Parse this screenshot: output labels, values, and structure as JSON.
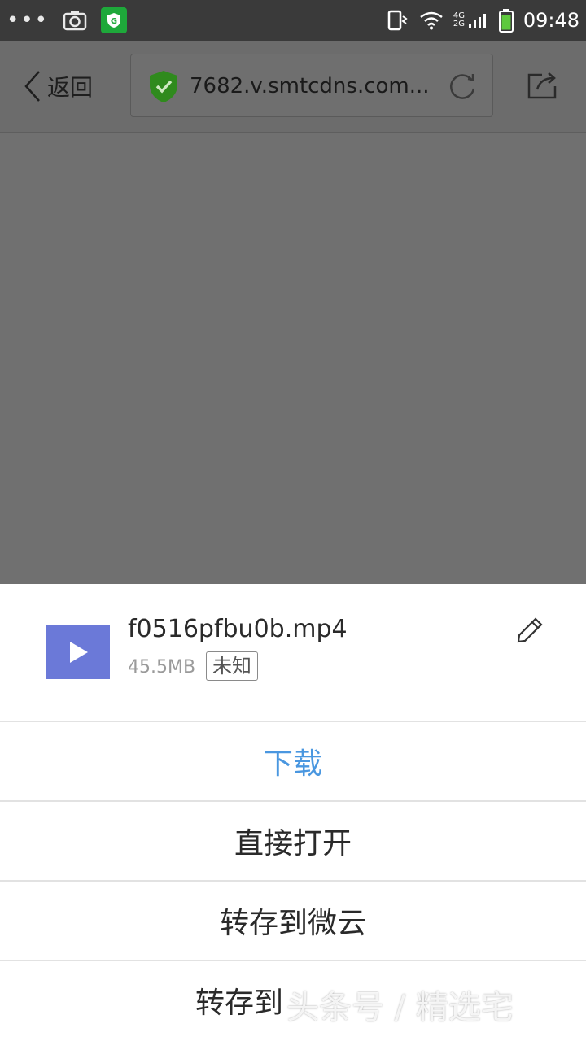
{
  "status_bar": {
    "time": "09:48",
    "network": "4G 2G",
    "icons": [
      "more-dots-icon",
      "camera-icon",
      "app-icon",
      "vibrate-icon",
      "wifi-icon",
      "signal-icon",
      "battery-icon"
    ]
  },
  "toolbar": {
    "back_label": "返回",
    "url": "7682.v.smtcdns.com...",
    "icons": [
      "chevron-left-icon",
      "shield-check-icon",
      "refresh-icon",
      "share-icon"
    ]
  },
  "sheet": {
    "file": {
      "name": "f0516pfbu0b.mp4",
      "size": "45.5MB",
      "type_badge": "未知"
    },
    "actions": [
      {
        "label": "下载"
      },
      {
        "label": "直接打开"
      },
      {
        "label": "转存到微云"
      },
      {
        "label": "转存到"
      }
    ]
  },
  "watermark": "头条号 / 精选宅",
  "colors": {
    "accent": "#4a97e0",
    "thumb": "#6b79d8",
    "shield": "#2f8a1d",
    "app_icon": "#1ea83a"
  }
}
